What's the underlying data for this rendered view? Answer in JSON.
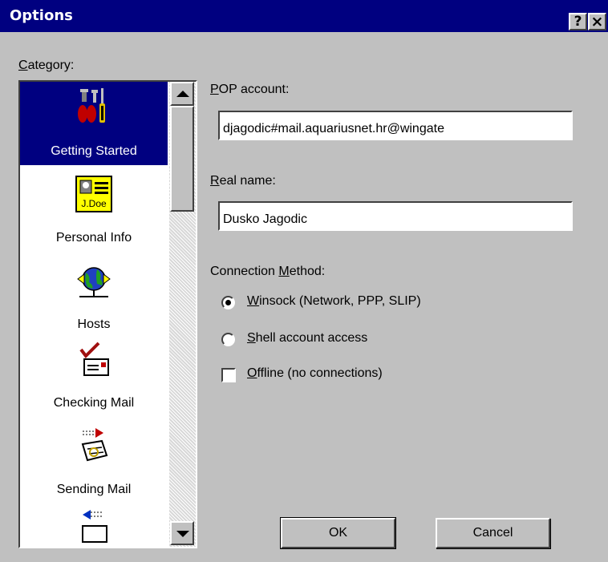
{
  "window": {
    "title": "Options",
    "help_label": "?",
    "close_label": "×"
  },
  "category": {
    "label_accel": "C",
    "label_rest": "ategory:",
    "items": [
      {
        "label": "Getting Started",
        "icon": "tools-icon",
        "selected": true
      },
      {
        "label": "Personal Info",
        "icon": "id-card-icon",
        "selected": false
      },
      {
        "label": "Hosts",
        "icon": "network-globe-icon",
        "selected": false
      },
      {
        "label": "Checking Mail",
        "icon": "check-mail-icon",
        "selected": false
      },
      {
        "label": "Sending Mail",
        "icon": "send-mail-icon",
        "selected": false
      }
    ],
    "id_card_text": "J.Doe"
  },
  "form": {
    "pop_account": {
      "label_accel": "P",
      "label_rest": "OP account:",
      "value": "djagodic#mail.aquariusnet.hr@wingate"
    },
    "real_name": {
      "label_accel": "R",
      "label_rest": "eal name:",
      "value": "Dusko Jagodic"
    },
    "connection": {
      "label_pre": "Connection ",
      "label_accel": "M",
      "label_post": "ethod:",
      "winsock": {
        "accel": "W",
        "rest": "insock (Network, PPP, SLIP)",
        "selected": true
      },
      "shell": {
        "accel": "S",
        "rest": "hell account access",
        "selected": false
      },
      "offline": {
        "accel": "O",
        "rest": "ffline (no connections)",
        "checked": false
      }
    }
  },
  "buttons": {
    "ok": "OK",
    "cancel": "Cancel"
  },
  "colors": {
    "title_bar": "#000080",
    "face": "#c0c0c0",
    "selection": "#000080"
  }
}
